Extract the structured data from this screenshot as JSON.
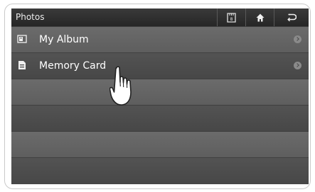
{
  "header": {
    "title": "Photos",
    "buttons": [
      {
        "icon": "card-icon"
      },
      {
        "icon": "home-icon"
      },
      {
        "icon": "back-icon"
      }
    ]
  },
  "list": {
    "items": [
      {
        "label": "My Album",
        "icon": "album-icon"
      },
      {
        "label": "Memory Card",
        "icon": "memory-card-icon"
      }
    ]
  },
  "colors": {
    "header": "#2d2d2d",
    "row_light": "#666666",
    "row_dark": "#4d4d4d",
    "text": "#ffffff"
  },
  "overlay": {
    "icon": "pointing-hand-icon"
  }
}
